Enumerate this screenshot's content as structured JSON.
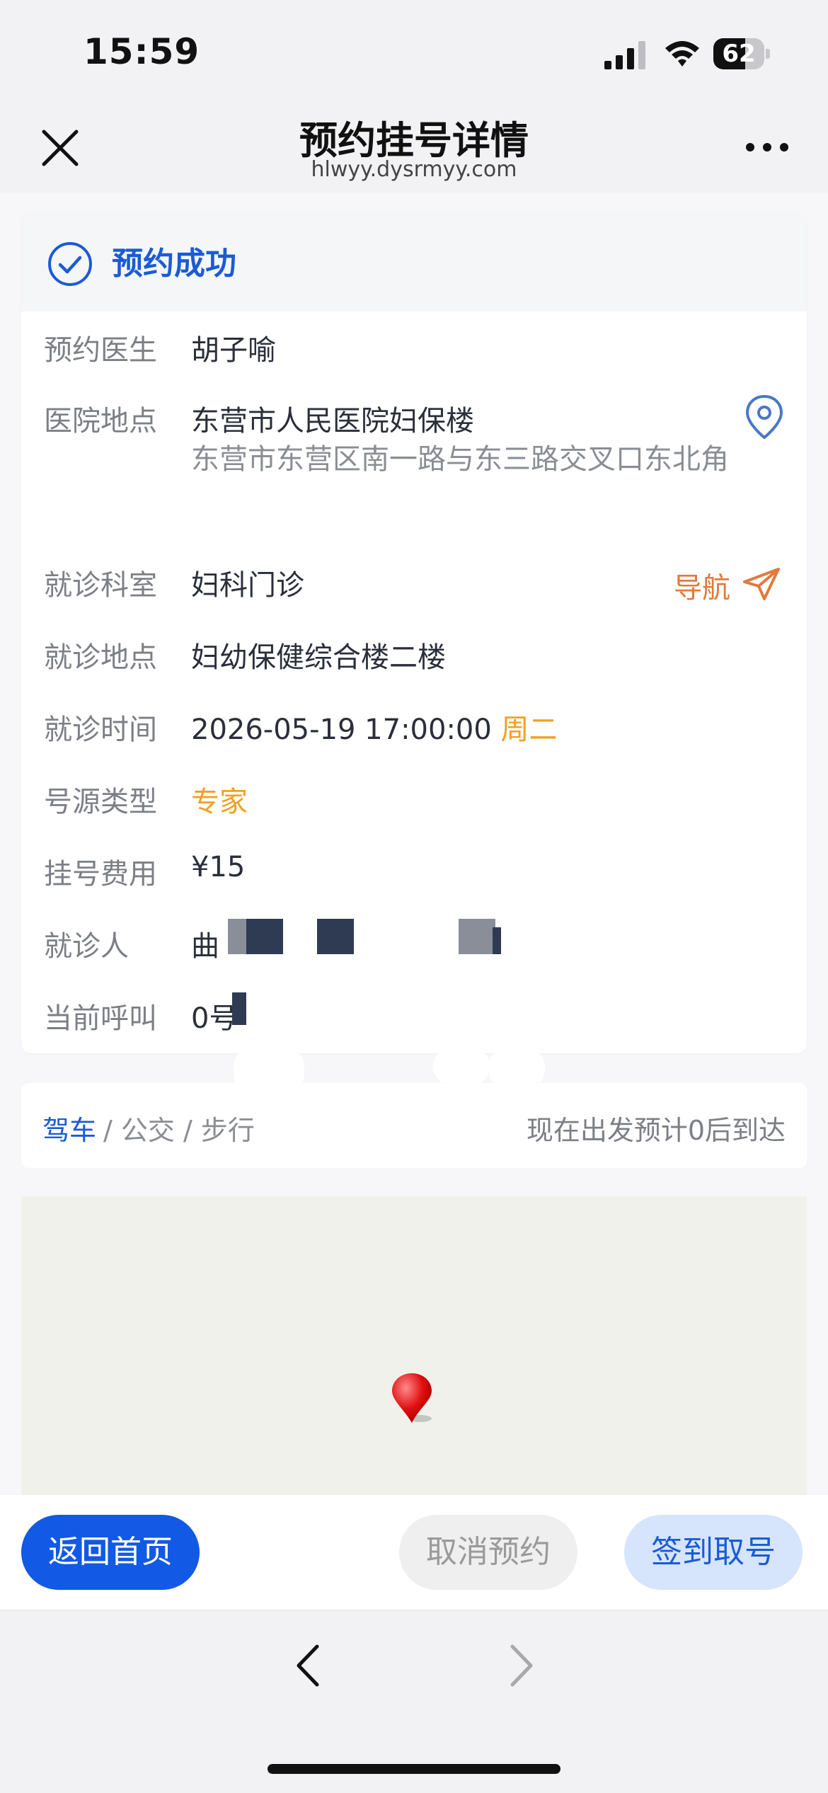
{
  "status_bar": {
    "time": "15:59",
    "battery": 62,
    "battery_level": 0.62
  },
  "nav": {
    "title": "预约挂号详情",
    "url": "hlwyy.dysrmyy.com"
  },
  "status": {
    "text": "预约成功"
  },
  "details": {
    "doctor": {
      "label": "预约医生",
      "value": "胡子喻"
    },
    "hospital": {
      "label": "医院地点",
      "value": "东营市人民医院妇保楼",
      "address": "东营市东营区南一路与东三路交叉口东北角"
    },
    "department": {
      "label": "就诊科室",
      "value": "妇科门诊",
      "nav_label": "导航"
    },
    "location": {
      "label": "就诊地点",
      "value": "妇幼保健综合楼二楼"
    },
    "time": {
      "label": "就诊时间",
      "value": "2026-05-19 17:00:00",
      "weekday": "周二"
    },
    "source_type": {
      "label": "号源类型",
      "value": "专家"
    },
    "fee": {
      "label": "挂号费用",
      "value": "¥15"
    },
    "patient": {
      "label": "就诊人",
      "value": "曲"
    },
    "current_call": {
      "label": "当前呼叫",
      "value": "0号"
    }
  },
  "route": {
    "drive": "驾车",
    "rest": " / 公交 / 步行",
    "eta": "现在出发预计0后到达"
  },
  "actions": {
    "home": "返回首页",
    "cancel": "取消预约",
    "checkin": "签到取号"
  },
  "icons": {
    "close": "close-icon",
    "more": "more-icon",
    "success": "check-circle-icon",
    "location": "location-pin-icon",
    "navigate": "navigate-arrow-icon",
    "map_marker": "map-marker-icon",
    "back": "chevron-left-icon",
    "forward": "chevron-right-icon"
  },
  "colors": {
    "primary": "#1259e6",
    "accent_orange": "#f0a024",
    "nav_orange": "#e07a3c"
  }
}
